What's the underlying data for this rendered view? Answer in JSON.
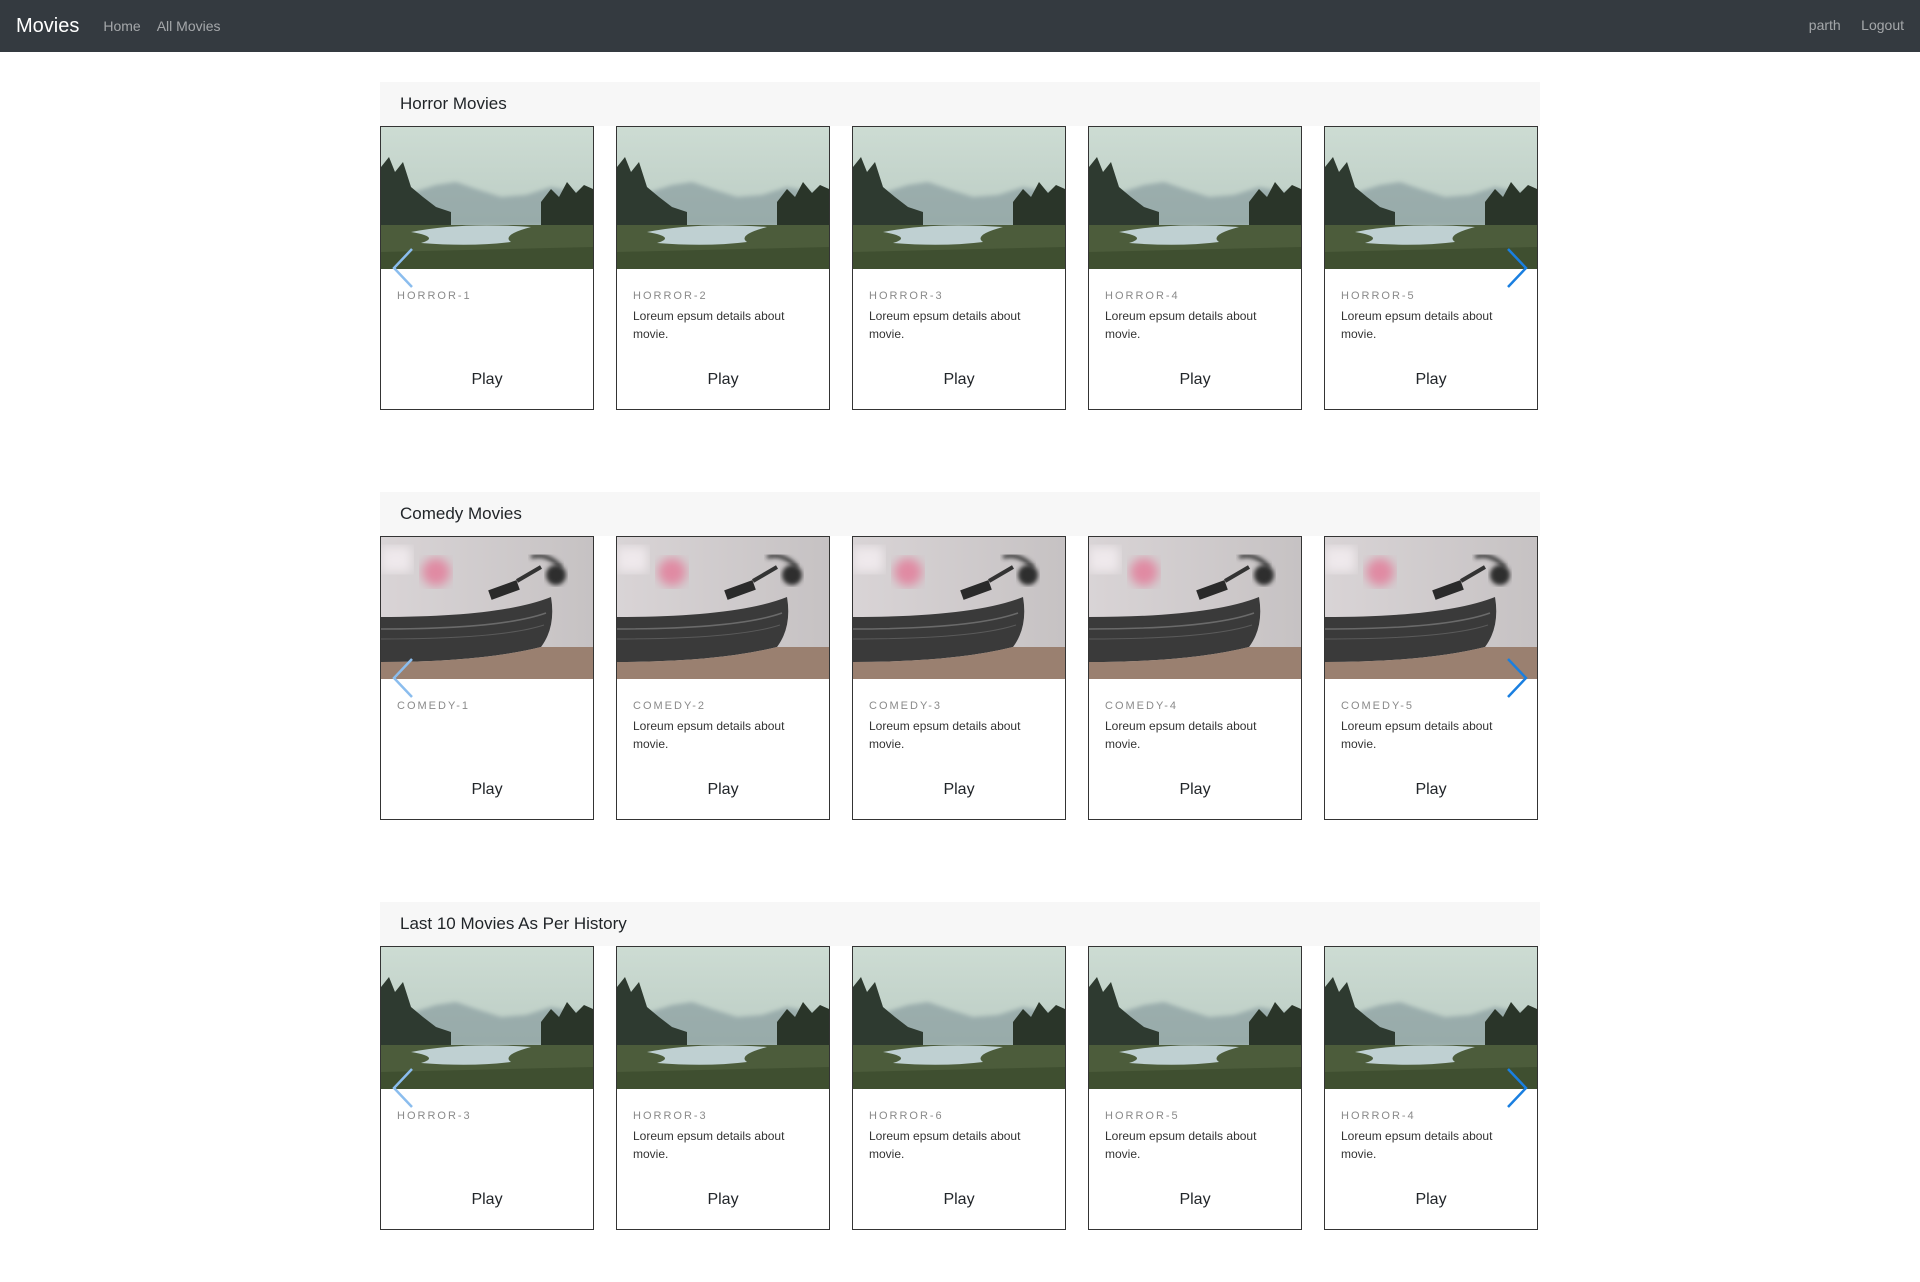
{
  "navbar": {
    "brand": "Movies",
    "links": [
      "Home",
      "All Movies"
    ],
    "user": "parth",
    "logout": "Logout"
  },
  "default_desc": "Loreum epsum details about movie.",
  "play_label": "Play",
  "sections": [
    {
      "title": "Horror Movies",
      "image": "forest-lake",
      "cards": [
        {
          "title": "HORROR-1"
        },
        {
          "title": "HORROR-2"
        },
        {
          "title": "HORROR-3"
        },
        {
          "title": "HORROR-4"
        },
        {
          "title": "HORROR-5"
        }
      ]
    },
    {
      "title": "Comedy Movies",
      "image": "turntable",
      "cards": [
        {
          "title": "COMEDY-1"
        },
        {
          "title": "COMEDY-2"
        },
        {
          "title": "COMEDY-3"
        },
        {
          "title": "COMEDY-4"
        },
        {
          "title": "COMEDY-5"
        }
      ]
    },
    {
      "title": "Last 10 Movies As Per History",
      "image": "forest-lake",
      "cards": [
        {
          "title": "HORROR-3"
        },
        {
          "title": "HORROR-3"
        },
        {
          "title": "HORROR-6"
        },
        {
          "title": "HORROR-5"
        },
        {
          "title": "HORROR-4"
        }
      ]
    }
  ],
  "colors": {
    "navbar_bg": "#343a40",
    "arrow_active": "#1a7fe0",
    "arrow_inactive": "#8bbdee"
  }
}
